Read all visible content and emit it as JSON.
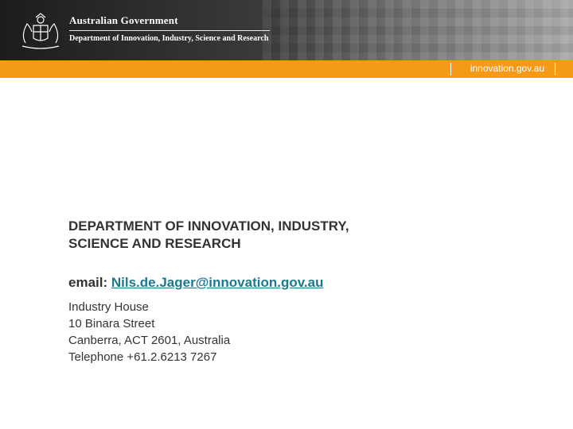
{
  "header": {
    "government": "Australian Government",
    "department": "Department of Innovation, Industry, Science and Research",
    "crest_icon": "coat-of-arms-icon",
    "site_url": "innovation.gov.au"
  },
  "colors": {
    "accent_orange": "#f59a16",
    "link_teal": "#1b7a8c",
    "text": "#333333"
  },
  "main": {
    "heading_line1": "DEPARTMENT OF INNOVATION, INDUSTRY,",
    "heading_line2": "SCIENCE AND RESEARCH",
    "email_label": "email:",
    "email_address": "Nils.de.Jager@innovation.gov.au",
    "address": [
      "Industry House",
      "10 Binara Street",
      "Canberra, ACT 2601, Australia",
      "Telephone +61.2.6213 7267"
    ]
  }
}
